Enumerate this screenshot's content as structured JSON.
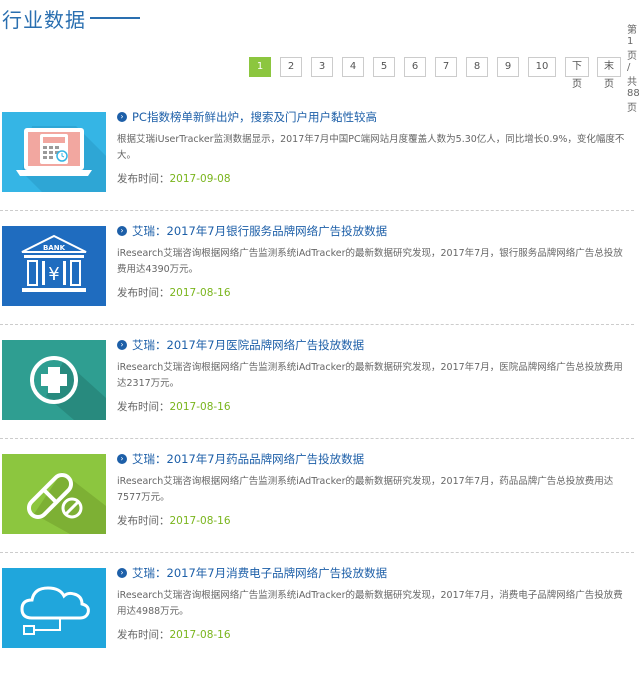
{
  "header": {
    "title": "行业数据"
  },
  "pagination": {
    "pages": [
      "1",
      "2",
      "3",
      "4",
      "5",
      "6",
      "7",
      "8",
      "9",
      "10"
    ],
    "current": "1",
    "next_label": "下页",
    "last_label": "末页",
    "info": "第1页 / 共88页"
  },
  "date_label": "发布时间：",
  "articles": [
    {
      "title": "PC指数榜单新鲜出炉，搜索及门户用户黏性较高",
      "desc": "根据艾瑞iUserTracker监测数据显示，2017年7月中国PC端网站月度覆盖人数为5.30亿人，同比增长0.9%，变化幅度不大。",
      "date": "2017-09-08",
      "icon": "laptop-calculator-icon",
      "bg": "#35b5e5"
    },
    {
      "title": "艾瑞：2017年7月银行服务品牌网络广告投放数据",
      "desc": "iResearch艾瑞咨询根据网络广告监测系统iAdTracker的最新数据研究发现，2017年7月，银行服务品牌网络广告总投放费用达4390万元。",
      "date": "2017-08-16",
      "icon": "bank-icon",
      "bank_text": "BANK",
      "bg": "#1f6cbf"
    },
    {
      "title": "艾瑞：2017年7月医院品牌网络广告投放数据",
      "desc": "iResearch艾瑞咨询根据网络广告监测系统iAdTracker的最新数据研究发现，2017年7月，医院品牌网络广告总投放费用达2317万元。",
      "date": "2017-08-16",
      "icon": "medical-cross-icon",
      "bg": "#2f9e91"
    },
    {
      "title": "艾瑞：2017年7月药品品牌网络广告投放数据",
      "desc": "iResearch艾瑞咨询根据网络广告监测系统iAdTracker的最新数据研究发现，2017年7月，药品品牌广告总投放费用达7577万元。",
      "date": "2017-08-16",
      "icon": "pill-icon",
      "bg": "#8cc63f"
    },
    {
      "title": "艾瑞：2017年7月消费电子品牌网络广告投放数据",
      "desc": "iResearch艾瑞咨询根据网络广告监测系统iAdTracker的最新数据研究发现，2017年7月，消费电子品牌网络广告投放费用达4988万元。",
      "date": "2017-08-16",
      "icon": "cloud-usb-icon",
      "bg": "#20a6dc"
    }
  ]
}
